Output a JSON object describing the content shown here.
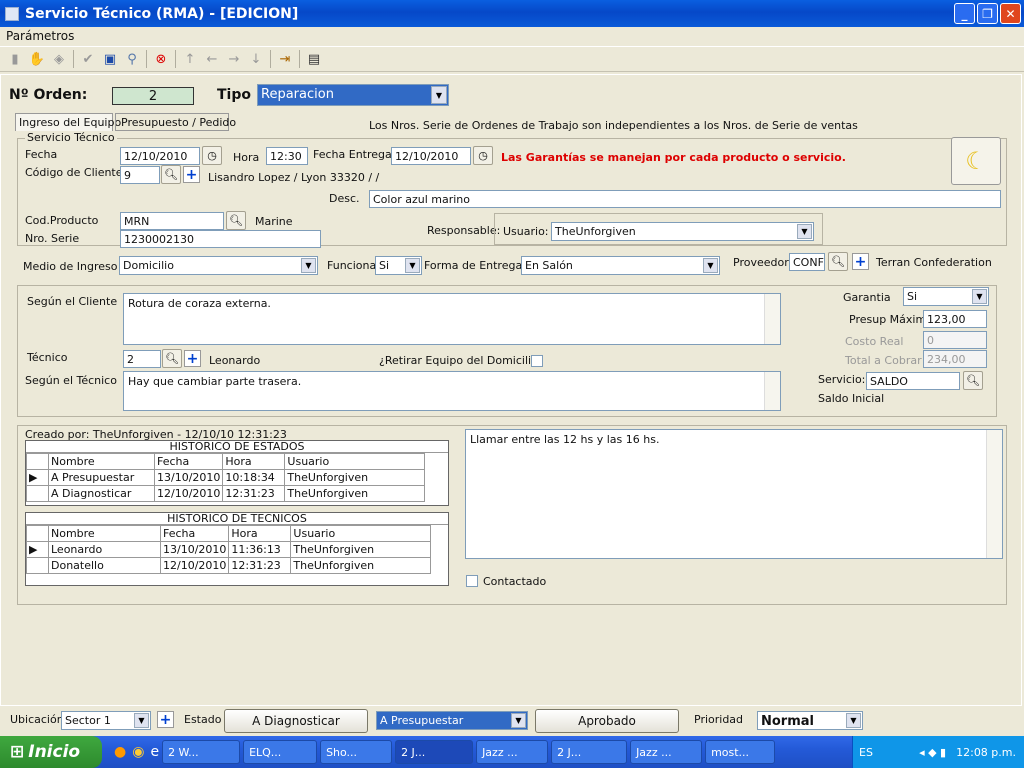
{
  "window": {
    "title": "Servicio Técnico (RMA) - [EDICION]",
    "menu": "Parámetros"
  },
  "header": {
    "orden_label": "Nº Orden:",
    "orden_value": "2",
    "tipo_label": "Tipo",
    "tipo_value": "Reparacion"
  },
  "tabs": [
    "Ingreso del Equipo",
    "Presupuesto / Pedido"
  ],
  "note": "Los Nros. Serie de Ordenes de Trabajo son independientes a los Nros. de Serie de ventas",
  "st": {
    "group": "Servicio Técnico",
    "fecha_label": "Fecha",
    "fecha": "12/10/2010",
    "hora_label": "Hora",
    "hora": "12:30",
    "fecha_entrega_label": "Fecha Entrega",
    "fecha_entrega": "12/10/2010",
    "warning": "Las Garantías se manejan por cada producto o servicio.",
    "cliente_label": "Código de Cliente",
    "cliente": "9",
    "cliente_name": "Lisandro Lopez / Lyon 33320 /  /",
    "desc_label": "Desc.",
    "desc": "Color azul marino",
    "codprod_label": "Cod.Producto",
    "codprod": "MRN",
    "codprod_name": "Marine",
    "serie_label": "Nro. Serie",
    "serie": "1230002130",
    "resp_label": "Responsable:",
    "usuario_label": "Usuario:",
    "usuario": "TheUnforgiven",
    "medio_label": "Medio de Ingreso",
    "medio": "Domicilio",
    "funciona_label": "Funciona",
    "funciona": "Si",
    "forma_label": "Forma de Entrega",
    "forma": "En Salón",
    "prov_label": "Proveedor:",
    "prov": "CONF",
    "prov_name": "Terran Confederation"
  },
  "detalle": {
    "cliente_label": "Según el Cliente",
    "cliente_text": "Rotura de coraza externa.",
    "tecnico_label": "Técnico",
    "tecnico": "2",
    "tecnico_name": "Leonardo",
    "retirar_label": "¿Retirar Equipo del Domicilio?",
    "segtec_label": "Según el Técnico",
    "segtec_text": "Hay que cambiar parte trasera.",
    "garantia_label": "Garantia",
    "garantia": "Si",
    "presup_label": "Presup Máximo",
    "presup": "123,00",
    "costo_label": "Costo Real",
    "costo": "0",
    "total_label": "Total a Cobrar",
    "total": "234,00",
    "servicio_label": "Servicio:",
    "servicio": "SALDO",
    "servicio_name": "Saldo Inicial"
  },
  "hist": {
    "creado": "Creado por: TheUnforgiven - 12/10/10 12:31:23",
    "estados_title": "HISTORICO DE ESTADOS",
    "tecnicos_title": "HISTORICO DE TECNICOS",
    "cols_estados": [
      "Nombre",
      "Fecha",
      "Hora",
      "Usuario"
    ],
    "estados": [
      [
        "A Presupuestar",
        "13/10/2010",
        "10:18:34",
        "TheUnforgiven"
      ],
      [
        "A Diagnosticar",
        "12/10/2010",
        "12:31:23",
        "TheUnforgiven"
      ]
    ],
    "cols_tecnicos": [
      "Nombre",
      "Fecha",
      "Hora",
      "Usuario"
    ],
    "tecnicos": [
      [
        "Leonardo",
        "13/10/2010",
        "11:36:13",
        "TheUnforgiven"
      ],
      [
        "Donatello",
        "12/10/2010",
        "12:31:23",
        "TheUnforgiven"
      ]
    ],
    "notas": "Llamar entre las 12 hs y las 16 hs.",
    "contactado_label": "Contactado"
  },
  "footer": {
    "ubic_label": "Ubicación",
    "ubic": "Sector 1",
    "estado_label": "Estado",
    "btn_diag": "A Diagnosticar",
    "estado": "A Presupuestar",
    "btn_aprob": "Aprobado",
    "prio_label": "Prioridad",
    "prio": "Normal"
  },
  "taskbar": {
    "start": "Inicio",
    "items": [
      "2 W...",
      "ELQ...",
      "Sho...",
      "2 J...",
      "Jazz ...",
      "2 J...",
      "Jazz ...",
      "most..."
    ],
    "lang": "ES",
    "time": "12:08 p.m."
  }
}
